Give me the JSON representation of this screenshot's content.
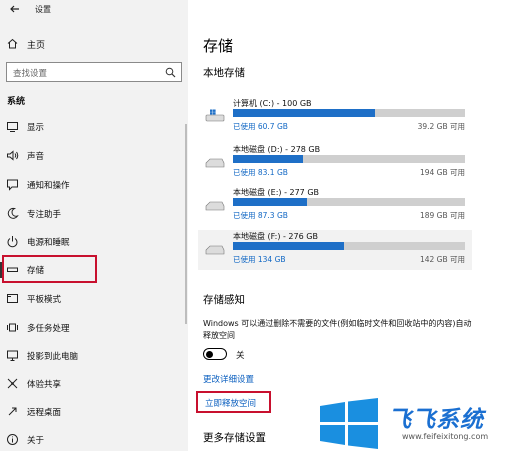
{
  "window": {
    "title": "设置"
  },
  "sidebar": {
    "home": "主页",
    "search_placeholder": "查找设置",
    "section": "系统",
    "items": [
      {
        "label": "显示",
        "icon": "monitor-icon"
      },
      {
        "label": "声音",
        "icon": "speaker-icon"
      },
      {
        "label": "通知和操作",
        "icon": "notification-icon"
      },
      {
        "label": "专注助手",
        "icon": "moon-icon"
      },
      {
        "label": "电源和睡眠",
        "icon": "power-icon"
      },
      {
        "label": "存储",
        "icon": "storage-icon",
        "selected": true
      },
      {
        "label": "平板模式",
        "icon": "tablet-icon"
      },
      {
        "label": "多任务处理",
        "icon": "multitask-icon"
      },
      {
        "label": "投影到此电脑",
        "icon": "project-icon"
      },
      {
        "label": "体验共享",
        "icon": "share-icon"
      },
      {
        "label": "远程桌面",
        "icon": "remote-desktop-icon"
      },
      {
        "label": "关于",
        "icon": "info-icon"
      }
    ]
  },
  "main": {
    "title": "存储",
    "local_storage": "本地存储",
    "drives": [
      {
        "name": "计算机 (C:) - 100 GB",
        "used": "已使用 60.7 GB",
        "free": "39.2 GB 可用",
        "fill": 0.61,
        "icon": "windows-drive-icon"
      },
      {
        "name": "本地磁盘 (D:) - 278 GB",
        "used": "已使用 83.1 GB",
        "free": "194 GB 可用",
        "fill": 0.3,
        "icon": "drive-icon"
      },
      {
        "name": "本地磁盘 (E:) - 277 GB",
        "used": "已使用 87.3 GB",
        "free": "189 GB 可用",
        "fill": 0.32,
        "icon": "drive-icon"
      },
      {
        "name": "本地磁盘 (F:) - 276 GB",
        "used": "已使用 134 GB",
        "free": "142 GB 可用",
        "fill": 0.48,
        "icon": "drive-icon"
      }
    ],
    "storage_sense": {
      "title": "存储感知",
      "description": "Windows 可以通过删除不需要的文件(例如临时文件和回收站中的内容)自动释放空间",
      "toggle_label": "关",
      "toggle_on": false,
      "change_link": "更改详细设置",
      "free_now_link": "立即释放空间"
    },
    "more_settings": "更多存储设置"
  },
  "watermark": {
    "brand": "飞飞系统",
    "url": "www.feifeixitong.com"
  },
  "colors": {
    "accent": "#1e6fc7",
    "link": "#0b5fbf",
    "highlight_box": "#c8102e",
    "sidebar_bg": "#f2f2f2"
  }
}
